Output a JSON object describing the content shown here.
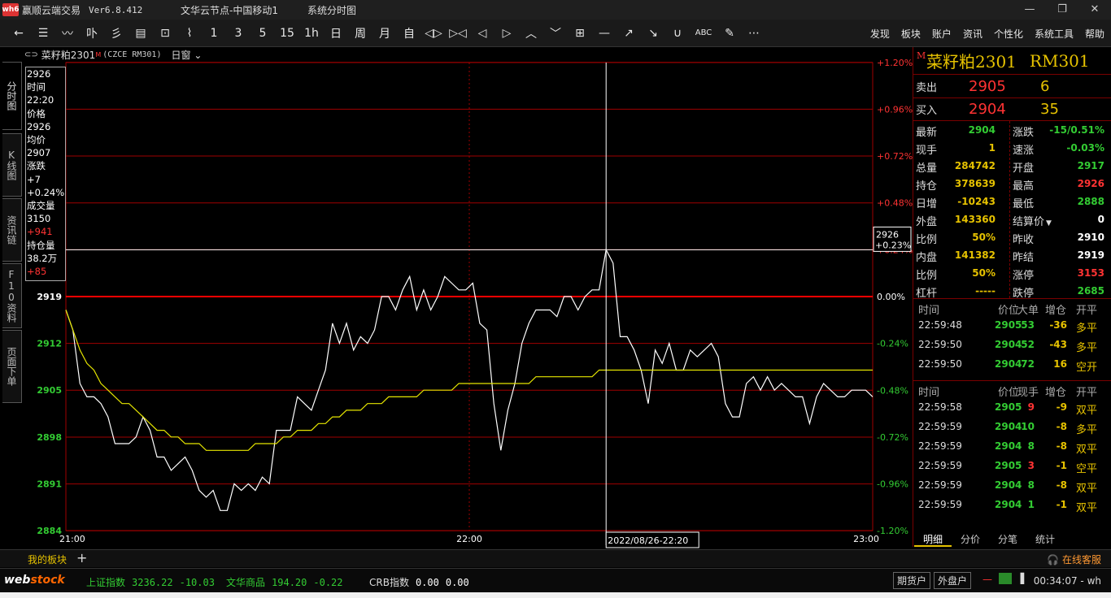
{
  "window": {
    "logo": "wh6",
    "app_title": "赢顺云端交易",
    "version": "Ver6.8.412",
    "node": "文华云节点-中国移动1",
    "view_name": "系统分时图",
    "controls": [
      "—",
      "❐",
      "✕"
    ]
  },
  "toolbar": {
    "tools": [
      "←",
      "☰",
      "〰",
      "卟",
      "彡",
      "▤",
      "⊡",
      "⌇",
      "1",
      "3",
      "5",
      "15",
      "1h",
      "日",
      "周",
      "月",
      "自",
      "◁▷",
      "▷◁",
      "◁",
      "▷",
      "︿",
      "﹀",
      "⊞",
      "—",
      "↗",
      "↘",
      "∪",
      "ABC",
      "✎",
      "⋯"
    ],
    "menus": [
      "发现",
      "板块",
      "账户",
      "资讯",
      "个性化",
      "系统工具",
      "帮助"
    ]
  },
  "side_tabs": [
    "分时图",
    "K线图",
    "资讯链",
    "F10资料",
    "页面下单"
  ],
  "chart_header": {
    "symbol": "菜籽粕2301",
    "marker": "M",
    "code": "(CZCE RM301)",
    "period": "日窗"
  },
  "crosshair_info": {
    "rows": [
      {
        "text": "2926",
        "red": false
      },
      {
        "text": "时间",
        "red": false
      },
      {
        "text": "22:20",
        "red": false
      },
      {
        "text": "价格",
        "red": false
      },
      {
        "text": "2926",
        "red": false
      },
      {
        "text": "均价",
        "red": false
      },
      {
        "text": "2907",
        "red": false
      },
      {
        "text": "涨跌",
        "red": false
      },
      {
        "text": "+7",
        "red": false
      },
      {
        "text": "+0.24%",
        "red": false
      },
      {
        "text": "成交量",
        "red": false
      },
      {
        "text": "3150",
        "red": false
      },
      {
        "text": "+941",
        "red": true
      },
      {
        "text": "持仓量",
        "red": false
      },
      {
        "text": "38.2万",
        "red": false
      },
      {
        "text": "+85",
        "red": true
      }
    ],
    "price_tag": "2926",
    "pct_tag": "+0.23%",
    "date_tag": "2022/08/26-22:20"
  },
  "chart_data": {
    "type": "line",
    "prev_settle": 2919,
    "y_ticks_left": [
      "2919",
      "2912",
      "2905",
      "2898",
      "2891",
      "2884"
    ],
    "y_ticks_right": [
      "+1.20%",
      "+0.96%",
      "+0.72%",
      "+0.48%",
      "+0.24%",
      "0.00%",
      "-0.24%",
      "-0.48%",
      "-0.72%",
      "-0.96%",
      "-1.20%"
    ],
    "x_ticks": [
      "21:00",
      "22:00",
      "23:00"
    ],
    "ylim": [
      2884,
      2954
    ],
    "grid": true,
    "series": [
      {
        "values": [
          2917,
          2914,
          2906,
          2904,
          2904,
          2903,
          2901,
          2897,
          2897,
          2897,
          2898,
          2901,
          2899,
          2895,
          2895,
          2893,
          2894,
          2895,
          2893,
          2890,
          2889,
          2890,
          2887,
          2887,
          2891,
          2890,
          2891,
          2890,
          2892,
          2891,
          2899,
          2899,
          2899,
          2904,
          2903,
          2902,
          2905,
          2908,
          2915,
          2912,
          2915,
          2911,
          2913,
          2912,
          2914,
          2919,
          2919,
          2917,
          2920,
          2922,
          2917,
          2920,
          2917,
          2919,
          2922,
          2921,
          2920,
          2920,
          2921,
          2915,
          2914,
          2903,
          2896,
          2902,
          2906,
          2912,
          2915,
          2917,
          2917,
          2917,
          2916,
          2919,
          2919,
          2917,
          2919,
          2920,
          2920,
          2926,
          2924,
          2913,
          2913,
          2911,
          2908,
          2903,
          2911,
          2909,
          2912,
          2908,
          2908,
          2911,
          2910,
          2911,
          2912,
          2910,
          2903,
          2901,
          2901,
          2906,
          2907,
          2905,
          2907,
          2905,
          2906,
          2905,
          2904,
          2904,
          2900,
          2904,
          2906,
          2905,
          2904,
          2904,
          2905,
          2905,
          2905,
          2904
        ]
      },
      {
        "values": [
          2917,
          2914,
          2911,
          2909,
          2908,
          2906,
          2905,
          2904,
          2903,
          2903,
          2902,
          2901,
          2900,
          2899,
          2899,
          2898,
          2898,
          2897,
          2897,
          2897,
          2896,
          2896,
          2896,
          2896,
          2896,
          2896,
          2896,
          2897,
          2897,
          2897,
          2897,
          2898,
          2898,
          2899,
          2899,
          2899,
          2900,
          2900,
          2901,
          2901,
          2902,
          2902,
          2902,
          2903,
          2903,
          2903,
          2904,
          2904,
          2904,
          2904,
          2904,
          2905,
          2905,
          2905,
          2905,
          2905,
          2906,
          2906,
          2906,
          2906,
          2906,
          2906,
          2906,
          2906,
          2906,
          2906,
          2906,
          2907,
          2907,
          2907,
          2907,
          2907,
          2907,
          2907,
          2907,
          2907,
          2908,
          2908,
          2908,
          2908,
          2908,
          2908,
          2908,
          2908,
          2908,
          2908,
          2908,
          2908,
          2908,
          2908,
          2908,
          2908,
          2908,
          2908,
          2908,
          2908,
          2908,
          2908,
          2908,
          2908,
          2908,
          2908,
          2908,
          2908,
          2908,
          2908,
          2908,
          2908,
          2908,
          2908,
          2908,
          2908,
          2908,
          2908,
          2908,
          2908
        ]
      }
    ],
    "colors": {
      "price": "#ffffff",
      "avg": "#e6e600",
      "grid": "#a00000",
      "baseline": "#ff0000"
    }
  },
  "quote": {
    "marker": "M",
    "name": "菜籽粕2301",
    "code": "RM301",
    "sell": {
      "label": "卖出",
      "price": "2905",
      "vol": "6"
    },
    "buy": {
      "label": "买入",
      "price": "2904",
      "vol": "35"
    },
    "rows": [
      {
        "l1": "最新",
        "v1": "2904",
        "c1": "g",
        "l2": "涨跌",
        "v2": "-15/0.51%",
        "c2": "g"
      },
      {
        "l1": "现手",
        "v1": "1",
        "c1": "y",
        "l2": "速涨",
        "v2": "-0.03%",
        "c2": "g"
      },
      {
        "l1": "总量",
        "v1": "284742",
        "c1": "y",
        "l2": "开盘",
        "v2": "2917",
        "c2": "g"
      },
      {
        "l1": "持仓",
        "v1": "378639",
        "c1": "y",
        "l2": "最高",
        "v2": "2926",
        "c2": "rd"
      },
      {
        "l1": "日增",
        "v1": "-10243",
        "c1": "y",
        "l2": "最低",
        "v2": "2888",
        "c2": "g"
      },
      {
        "l1": "外盘",
        "v1": "143360",
        "c1": "y",
        "l2": "结算价",
        "v2": "0",
        "c2": "w"
      },
      {
        "l1": "比例",
        "v1": "50%",
        "c1": "y",
        "l2": "昨收",
        "v2": "2910",
        "c2": "w"
      },
      {
        "l1": "内盘",
        "v1": "141382",
        "c1": "y",
        "l2": "昨结",
        "v2": "2919",
        "c2": "w"
      },
      {
        "l1": "比例",
        "v1": "50%",
        "c1": "y",
        "l2": "涨停",
        "v2": "3153",
        "c2": "rd"
      },
      {
        "l1": "杠杆",
        "v1": "-----",
        "c1": "y",
        "l2": "跌停",
        "v2": "2685",
        "c2": "g"
      }
    ],
    "block_headers": [
      "时间",
      "价位",
      "大单",
      "增仓",
      "开平"
    ],
    "block_trades": [
      {
        "time": "22:59:48",
        "price": "2905",
        "price_color": "g",
        "vol": "53",
        "vol_color": "g",
        "oi": "-36",
        "type": "多平"
      },
      {
        "time": "22:59:50",
        "price": "2904",
        "price_color": "g",
        "vol": "52",
        "vol_color": "g",
        "oi": "-43",
        "type": "多平"
      },
      {
        "time": "22:59:50",
        "price": "2904",
        "price_color": "g",
        "vol": "72",
        "vol_color": "g",
        "oi": "16",
        "type": "空开"
      }
    ],
    "tick_headers": [
      "时间",
      "价位",
      "现手",
      "增仓",
      "开平"
    ],
    "ticks": [
      {
        "time": "22:59:58",
        "price": "2905",
        "price_color": "g",
        "vol": "9",
        "vol_color": "rd",
        "oi": "-9",
        "type": "双平"
      },
      {
        "time": "22:59:59",
        "price": "2904",
        "price_color": "g",
        "vol": "10",
        "vol_color": "g",
        "oi": "-8",
        "type": "多平"
      },
      {
        "time": "22:59:59",
        "price": "2904",
        "price_color": "g",
        "vol": "8",
        "vol_color": "g",
        "oi": "-8",
        "type": "双平"
      },
      {
        "time": "22:59:59",
        "price": "2905",
        "price_color": "g",
        "vol": "3",
        "vol_color": "rd",
        "oi": "-1",
        "type": "空平"
      },
      {
        "time": "22:59:59",
        "price": "2904",
        "price_color": "g",
        "vol": "8",
        "vol_color": "g",
        "oi": "-8",
        "type": "双平"
      },
      {
        "time": "22:59:59",
        "price": "2904",
        "price_color": "g",
        "vol": "1",
        "vol_color": "g",
        "oi": "-1",
        "type": "双平"
      }
    ],
    "tabs": [
      "明细",
      "分价",
      "分笔",
      "统计"
    ]
  },
  "boardbar": {
    "my_board": "我的板块",
    "plus": "+",
    "service": "在线客服"
  },
  "statusbar": {
    "logo_a": "web",
    "logo_b": "stock",
    "indices": [
      {
        "name": "上证指数",
        "value": "3236.22",
        "change": "-10.03"
      },
      {
        "name": "文华商品",
        "value": "194.20",
        "change": "-0.22"
      },
      {
        "name": "CRB指数",
        "value": "0.00",
        "change": "0.00"
      }
    ],
    "buttons": [
      "期货户",
      "外盘户"
    ],
    "clock": "00:34:07 - wh"
  }
}
